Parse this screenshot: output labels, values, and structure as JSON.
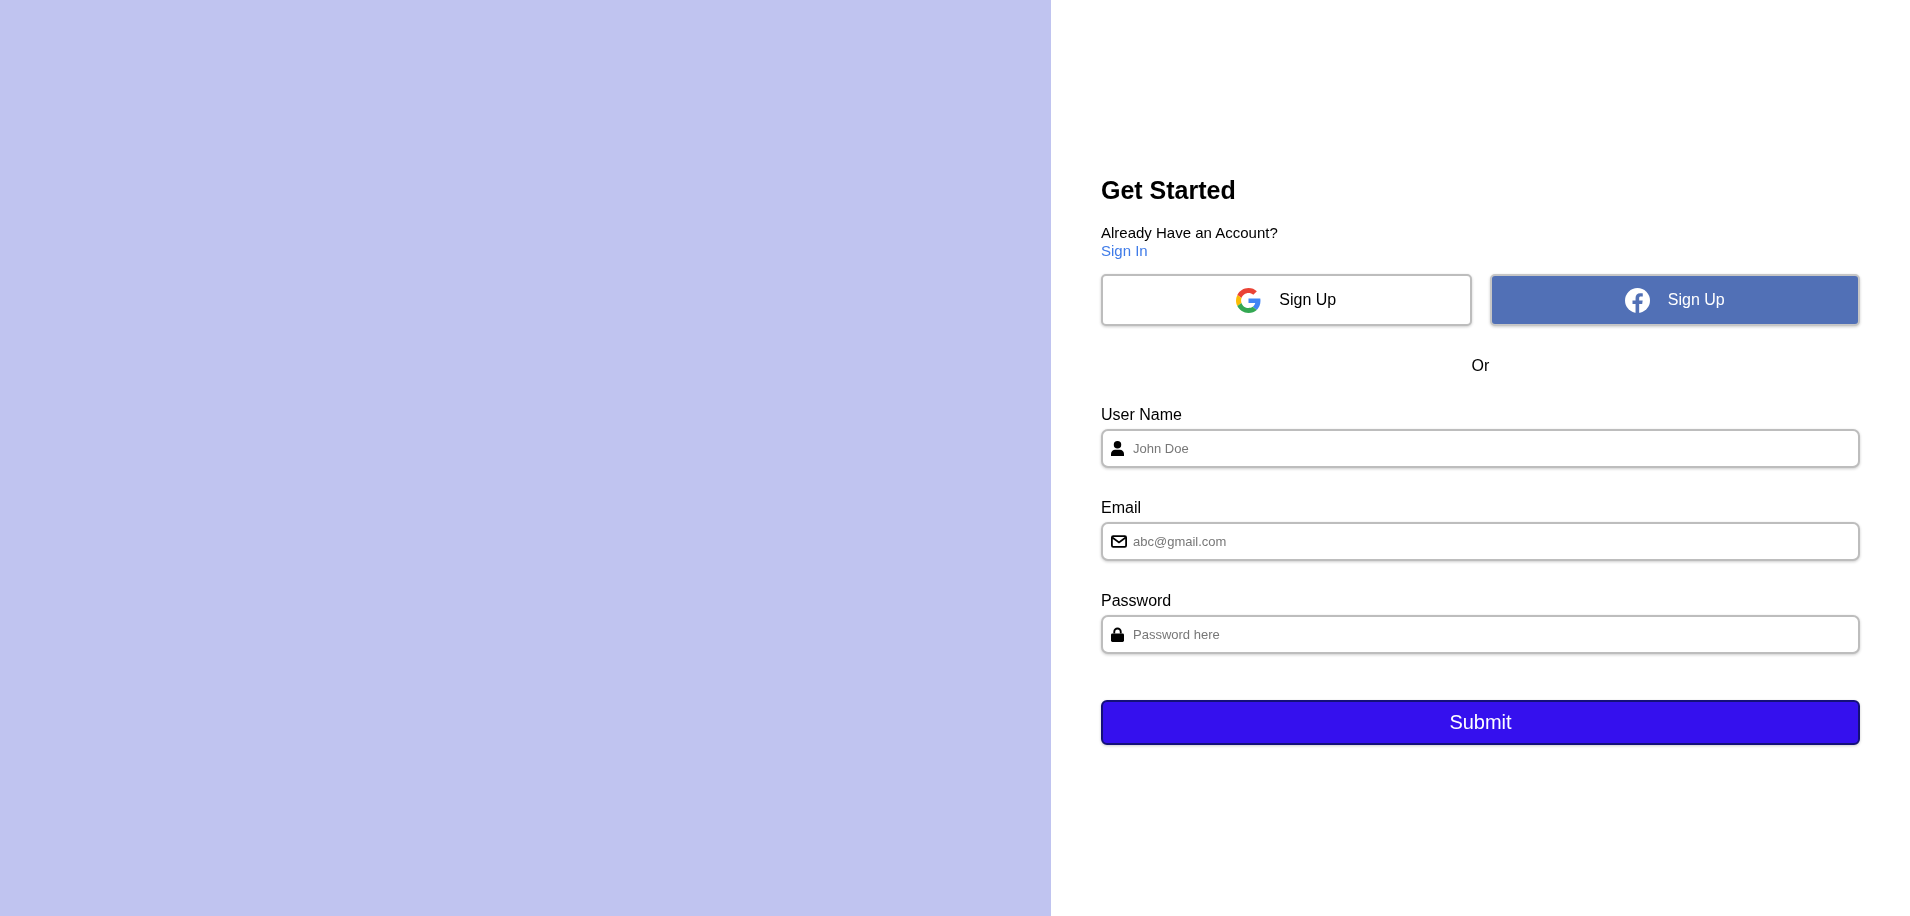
{
  "heading": "Get Started",
  "account_prompt": {
    "text": "Already Have an Account?",
    "link": "Sign In"
  },
  "social_buttons": [
    {
      "kind": "google",
      "label": "Sign Up"
    },
    {
      "kind": "facebook",
      "label": "Sign Up"
    }
  ],
  "divider_text": "Or",
  "fields": [
    {
      "kind": "user",
      "label": "User Name",
      "placeholder": "John Doe"
    },
    {
      "kind": "email",
      "label": "Email",
      "placeholder": "abc@gmail.com"
    },
    {
      "kind": "password",
      "label": "Password",
      "placeholder": "Password here"
    }
  ],
  "submit": "Submit"
}
